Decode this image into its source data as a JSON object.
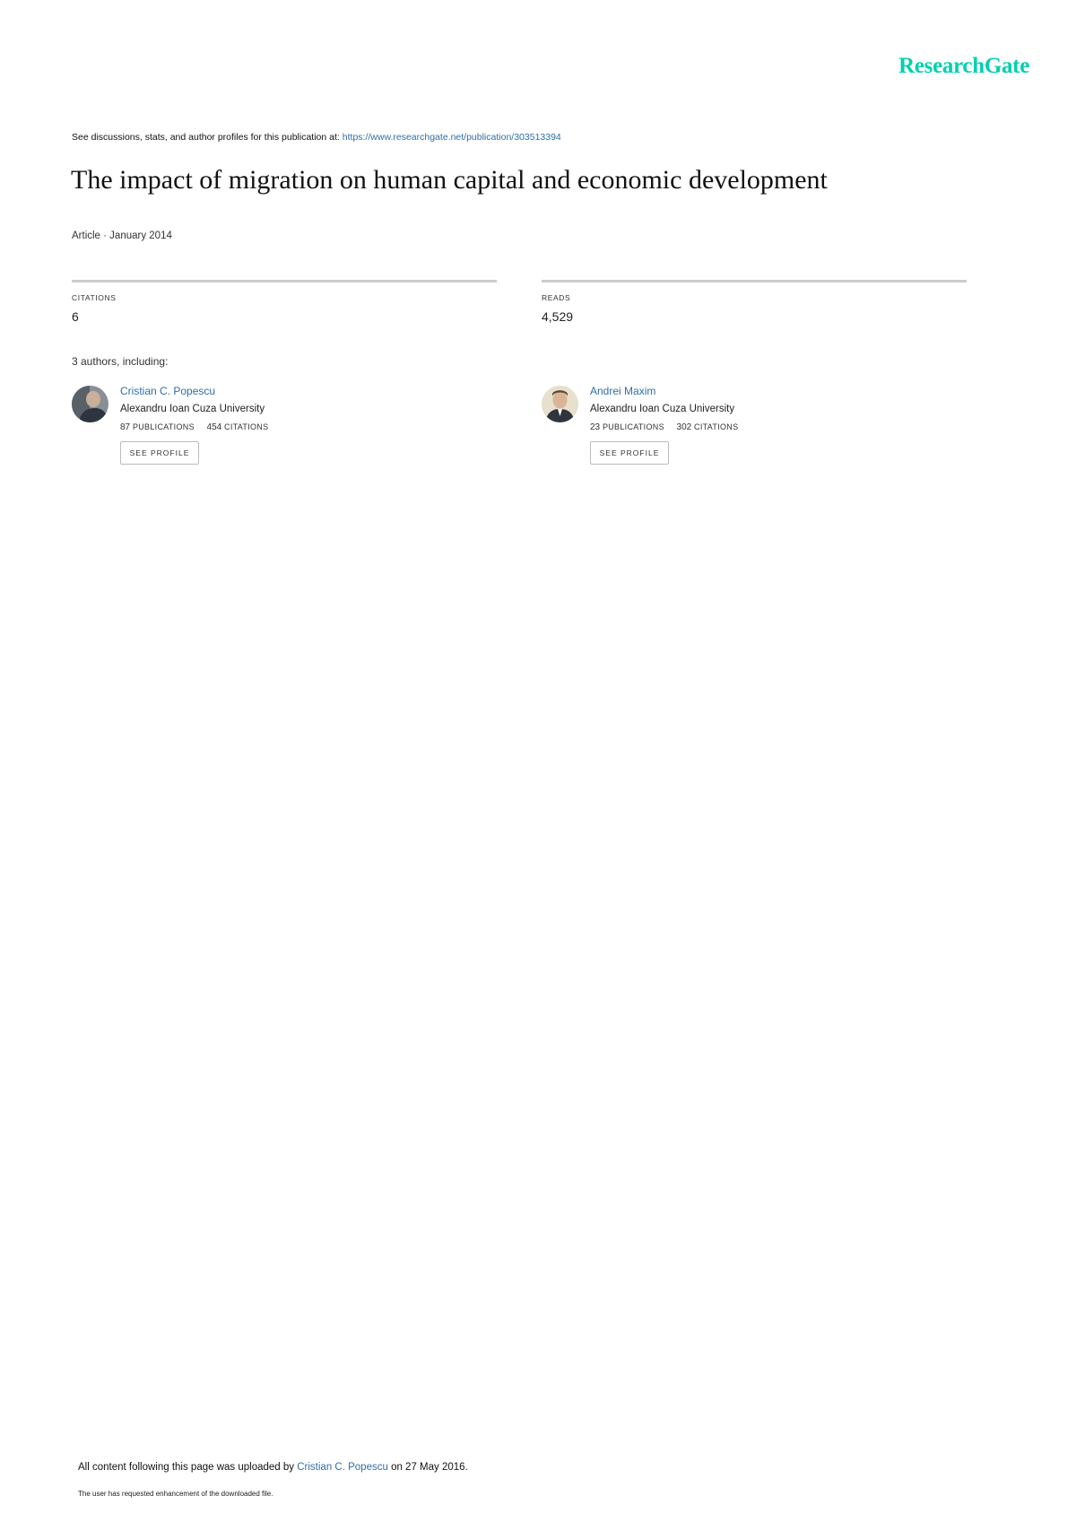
{
  "header": {
    "logo_text": "ResearchGate",
    "discussion_prefix": "See discussions, stats, and author profiles for this publication at:",
    "publication_url": "https://www.researchgate.net/publication/303513394"
  },
  "publication": {
    "title": "The impact of migration on human capital and economic development",
    "meta": "Article · January 2014"
  },
  "stats": {
    "citations_label": "CITATIONS",
    "citations_value": "6",
    "reads_label": "READS",
    "reads_value": "4,529"
  },
  "authors": {
    "heading": "3 authors, including:",
    "list": [
      {
        "name": "Cristian C. Popescu",
        "affiliation": "Alexandru Ioan Cuza University",
        "publications_count": "87",
        "publications_label": "PUBLICATIONS",
        "citations_count": "454",
        "citations_label": "CITATIONS",
        "button_label": "SEE PROFILE"
      },
      {
        "name": "Andrei Maxim",
        "affiliation": "Alexandru Ioan Cuza University",
        "publications_count": "23",
        "publications_label": "PUBLICATIONS",
        "citations_count": "302",
        "citations_label": "CITATIONS",
        "button_label": "SEE PROFILE"
      }
    ]
  },
  "footer": {
    "uploaded_prefix": "All content following this page was uploaded by",
    "uploader": "Cristian C. Popescu",
    "uploaded_suffix": "on 27 May 2016.",
    "note": "The user has requested enhancement of the downloaded file."
  },
  "colors": {
    "brand": "#00d0af",
    "link": "#2f6ea8",
    "divider": "#cccccc"
  }
}
